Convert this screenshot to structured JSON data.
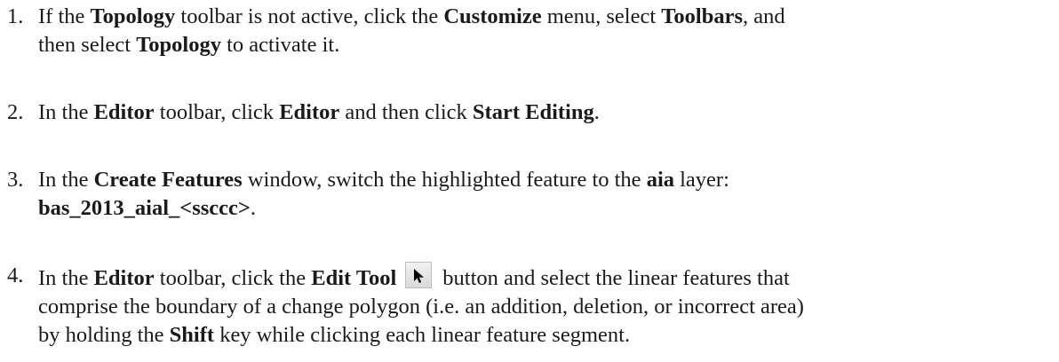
{
  "steps": [
    {
      "number": "1.",
      "lines": [
        [
          "If the ",
          {
            "b": "Topology"
          },
          " toolbar is not active, click the ",
          {
            "b": "Customize"
          },
          " menu, select ",
          {
            "b": "Toolbars"
          },
          ", and"
        ],
        [
          "then select ",
          {
            "b": "Topology"
          },
          " to activate it."
        ]
      ]
    },
    {
      "number": "2.",
      "lines": [
        [
          "In the ",
          {
            "b": "Editor"
          },
          " toolbar, click ",
          {
            "b": "Editor"
          },
          " and then click ",
          {
            "b": "Start Editing"
          },
          "."
        ]
      ]
    },
    {
      "number": "3.",
      "lines": [
        [
          "In the ",
          {
            "b": "Create Features"
          },
          " window, switch the highlighted feature to the ",
          {
            "b": "aia"
          },
          " layer:"
        ],
        [
          {
            "b": "bas_2013_aial_<ssccc>"
          },
          "."
        ]
      ]
    },
    {
      "number": "4.",
      "lines": [
        [
          "In the ",
          {
            "b": "Editor"
          },
          " toolbar, click the ",
          {
            "b": "Edit Tool"
          },
          {
            "icon": "edit-tool-arrow-icon"
          },
          "button and select the linear features that"
        ],
        [
          "comprise the boundary of a change polygon (i.e. an addition, deletion, or incorrect area)"
        ],
        [
          "by holding the ",
          {
            "b": "Shift"
          },
          " key while clicking each linear feature segment."
        ]
      ]
    }
  ]
}
